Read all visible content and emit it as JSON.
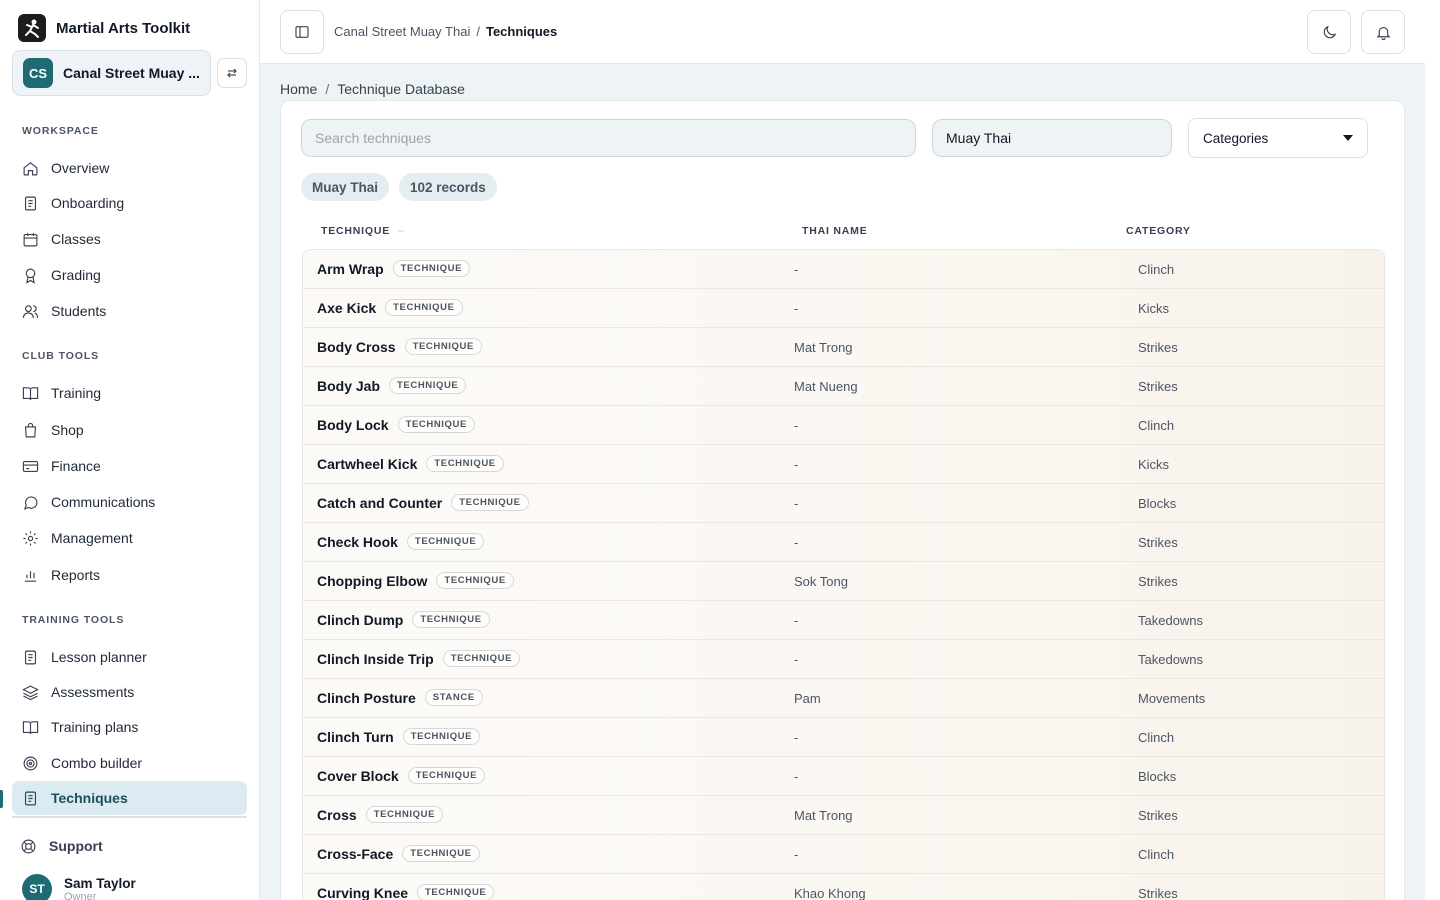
{
  "app": {
    "title": "Martial Arts Toolkit"
  },
  "club": {
    "initials": "CS",
    "name": "Canal Street Muay ..."
  },
  "sidebar": {
    "sections": [
      {
        "label": "WORKSPACE",
        "items": [
          {
            "label": "Overview",
            "icon": "home-icon"
          },
          {
            "label": "Onboarding",
            "icon": "clipboard-icon"
          },
          {
            "label": "Classes",
            "icon": "calendar-icon"
          },
          {
            "label": "Grading",
            "icon": "award-icon"
          },
          {
            "label": "Students",
            "icon": "users-icon"
          }
        ]
      },
      {
        "label": "CLUB TOOLS",
        "items": [
          {
            "label": "Training",
            "icon": "book-icon"
          },
          {
            "label": "Shop",
            "icon": "shopping-bag-icon"
          },
          {
            "label": "Finance",
            "icon": "credit-card-icon"
          },
          {
            "label": "Communications",
            "icon": "message-icon"
          },
          {
            "label": "Management",
            "icon": "gear-icon"
          },
          {
            "label": "Reports",
            "icon": "bar-chart-icon"
          }
        ]
      },
      {
        "label": "TRAINING TOOLS",
        "items": [
          {
            "label": "Lesson planner",
            "icon": "clipboard-icon"
          },
          {
            "label": "Assessments",
            "icon": "layers-icon"
          },
          {
            "label": "Training plans",
            "icon": "book-icon"
          },
          {
            "label": "Combo builder",
            "icon": "target-icon"
          },
          {
            "label": "Techniques",
            "icon": "document-icon",
            "active": true
          }
        ]
      }
    ],
    "support": "Support",
    "user": {
      "initials": "ST",
      "name": "Sam Taylor",
      "role": "Owner"
    }
  },
  "topbar": {
    "club": "Canal Street Muay Thai",
    "sep": "/",
    "current": "Techniques"
  },
  "breadcrumb": {
    "home": "Home",
    "sep": "/",
    "current": "Technique Database"
  },
  "filters": {
    "search_placeholder": "Search techniques",
    "discipline": "Muay Thai",
    "categories_label": "Categories"
  },
  "chips": {
    "discipline": "Muay Thai",
    "records": "102 records"
  },
  "table": {
    "columns": {
      "technique": "TECHNIQUE",
      "thai": "THAI NAME",
      "category": "CATEGORY"
    },
    "rows": [
      {
        "name": "Arm Wrap",
        "tag": "TECHNIQUE",
        "thai": "-",
        "category": "Clinch"
      },
      {
        "name": "Axe Kick",
        "tag": "TECHNIQUE",
        "thai": "-",
        "category": "Kicks"
      },
      {
        "name": "Body Cross",
        "tag": "TECHNIQUE",
        "thai": "Mat Trong",
        "category": "Strikes"
      },
      {
        "name": "Body Jab",
        "tag": "TECHNIQUE",
        "thai": "Mat Nueng",
        "category": "Strikes"
      },
      {
        "name": "Body Lock",
        "tag": "TECHNIQUE",
        "thai": "-",
        "category": "Clinch"
      },
      {
        "name": "Cartwheel Kick",
        "tag": "TECHNIQUE",
        "thai": "-",
        "category": "Kicks"
      },
      {
        "name": "Catch and Counter",
        "tag": "TECHNIQUE",
        "thai": "-",
        "category": "Blocks"
      },
      {
        "name": "Check Hook",
        "tag": "TECHNIQUE",
        "thai": "-",
        "category": "Strikes"
      },
      {
        "name": "Chopping Elbow",
        "tag": "TECHNIQUE",
        "thai": "Sok Tong",
        "category": "Strikes"
      },
      {
        "name": "Clinch Dump",
        "tag": "TECHNIQUE",
        "thai": "-",
        "category": "Takedowns"
      },
      {
        "name": "Clinch Inside Trip",
        "tag": "TECHNIQUE",
        "thai": "-",
        "category": "Takedowns"
      },
      {
        "name": "Clinch Posture",
        "tag": "STANCE",
        "thai": "Pam",
        "category": "Movements"
      },
      {
        "name": "Clinch Turn",
        "tag": "TECHNIQUE",
        "thai": "-",
        "category": "Clinch"
      },
      {
        "name": "Cover Block",
        "tag": "TECHNIQUE",
        "thai": "-",
        "category": "Blocks"
      },
      {
        "name": "Cross",
        "tag": "TECHNIQUE",
        "thai": "Mat Trong",
        "category": "Strikes"
      },
      {
        "name": "Cross-Face",
        "tag": "TECHNIQUE",
        "thai": "-",
        "category": "Clinch"
      },
      {
        "name": "Curving Knee",
        "tag": "TECHNIQUE",
        "thai": "Khao Khong",
        "category": "Strikes"
      }
    ]
  }
}
